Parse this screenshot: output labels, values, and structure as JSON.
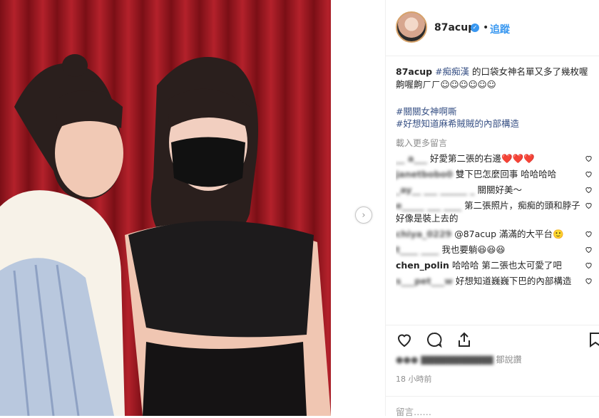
{
  "post": {
    "username": "87acup",
    "follow_label": "追蹤",
    "dot": "•",
    "caption_user": "87acup",
    "caption_tag": "#痴痴漢",
    "caption_text": " 的口袋女神名單又多了幾枚喔齁喔齁ㄏㄏ☺︎☺︎☺︎☺︎☺︎☺︎",
    "hashtag1": "#關關女神啊嘶",
    "hashtag2": "#好想知道麻希賊賊的內部構造",
    "load_more": "載入更多留言",
    "time": "18 小時前",
    "likes_text": "鄒說讚",
    "add_comment_placeholder": "留言……"
  },
  "comments": [
    {
      "user": "__ a___",
      "text": "好愛第二張的右邊❤️❤️❤️"
    },
    {
      "user": "janetbobo0",
      "text": "雙下巴怎麼回事 哈哈哈哈"
    },
    {
      "user": "_ay__ ___ ______ _",
      "text": "關關好美～"
    },
    {
      "user": "e_____ ___ ____",
      "text": "第二張照片，痴痴的頭和脖子好像是裝上去的"
    },
    {
      "user": "chiya_0229",
      "text": "@87acup 滿滿的大平台🙂"
    },
    {
      "user": "t____ ____",
      "text": "我也要躺😆😆😆"
    },
    {
      "user": "chen_polin",
      "text": "哈哈哈 第二張也太可愛了吧"
    },
    {
      "user": "s___pet___w",
      "text": "好想知道巍巍下巴的內部構造"
    }
  ],
  "icons": [
    "heart-icon",
    "comment-icon",
    "share-icon",
    "bookmark-icon",
    "verified-icon"
  ]
}
